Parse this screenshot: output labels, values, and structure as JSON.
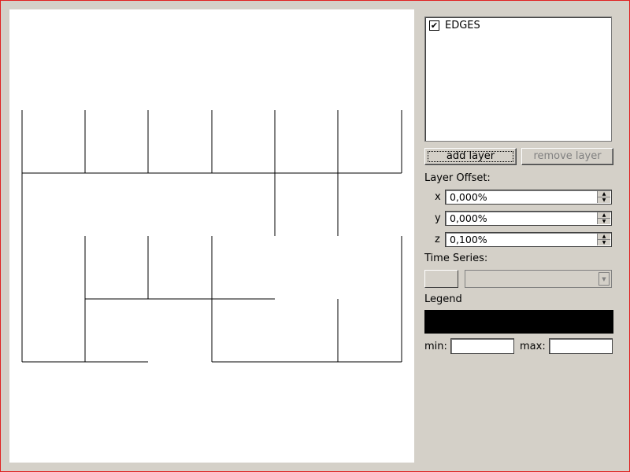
{
  "layers": {
    "items": [
      {
        "label": "EDGES",
        "checked": true
      }
    ],
    "add_label": "add layer",
    "remove_label": "remove layer"
  },
  "offset": {
    "title": "Layer Offset:",
    "x": {
      "label": "x",
      "value": "0,000%"
    },
    "y": {
      "label": "y",
      "value": "0,000%"
    },
    "z": {
      "label": "z",
      "value": "0,100%"
    }
  },
  "time_series": {
    "title": "Time Series:",
    "selected": ""
  },
  "legend": {
    "title": "Legend",
    "color": "#000000",
    "min_label": "min:",
    "min_value": "",
    "max_label": "max:",
    "max_value": ""
  },
  "colors": {
    "window_bg": "#d4d0c8",
    "canvas_bg": "#ffffff",
    "edge_stroke": "#000000",
    "window_border": "#e02020"
  }
}
